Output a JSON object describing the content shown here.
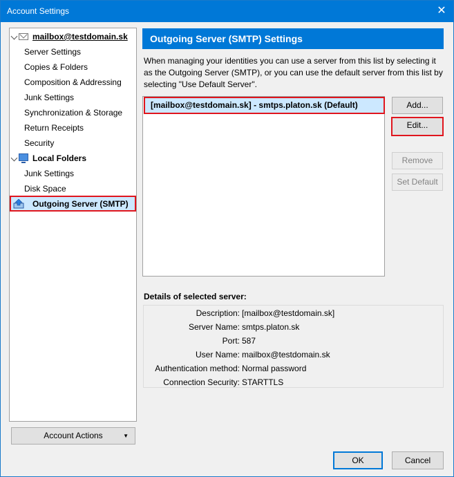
{
  "window": {
    "title": "Account Settings"
  },
  "tree": {
    "account": "mailbox@testdomain.sk",
    "account_items": [
      "Server Settings",
      "Copies & Folders",
      "Composition & Addressing",
      "Junk Settings",
      "Synchronization & Storage",
      "Return Receipts",
      "Security"
    ],
    "local_folders": "Local Folders",
    "local_items": [
      "Junk Settings",
      "Disk Space"
    ],
    "outgoing": "Outgoing Server (SMTP)"
  },
  "account_actions": "Account Actions",
  "panel": {
    "header": "Outgoing Server (SMTP) Settings",
    "intro": "When managing your identities you can use a server from this list by selecting it as the Outgoing Server (SMTP), or you can use the default server from this list by selecting \"Use Default Server\".",
    "servers": [
      "[mailbox@testdomain.sk] - smtps.platon.sk (Default)"
    ],
    "buttons": {
      "add": "Add...",
      "edit": "Edit...",
      "remove": "Remove",
      "set_default": "Set Default"
    },
    "details_label": "Details of selected server:",
    "details": [
      {
        "key": "Description:",
        "value": "[mailbox@testdomain.sk]"
      },
      {
        "key": "Server Name:",
        "value": "smtps.platon.sk"
      },
      {
        "key": "Port:",
        "value": "587"
      },
      {
        "key": "User Name:",
        "value": "mailbox@testdomain.sk"
      },
      {
        "key": "Authentication method:",
        "value": "Normal password"
      },
      {
        "key": "Connection Security:",
        "value": "STARTTLS"
      }
    ]
  },
  "footer": {
    "ok": "OK",
    "cancel": "Cancel"
  }
}
